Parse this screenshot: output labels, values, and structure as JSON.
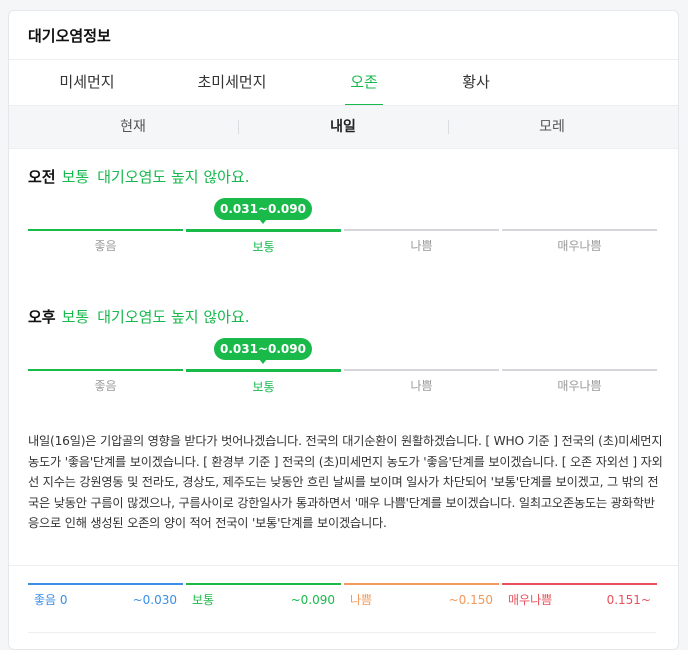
{
  "title": "대기오염정보",
  "tabs": [
    {
      "label": "미세먼지"
    },
    {
      "label": "초미세먼지"
    },
    {
      "label": "오존"
    },
    {
      "label": "황사"
    }
  ],
  "active_tab": "오존",
  "subtabs": [
    {
      "label": "현재"
    },
    {
      "label": "내일"
    },
    {
      "label": "모레"
    }
  ],
  "active_subtab": "내일",
  "periods": [
    {
      "time": "오전",
      "grade": "보통",
      "message": "대기오염도 높지 않아요.",
      "range": "0.031~0.090"
    },
    {
      "time": "오후",
      "grade": "보통",
      "message": "대기오염도 높지 않아요.",
      "range": "0.031~0.090"
    }
  ],
  "scale_labels": [
    "좋음",
    "보통",
    "나쁨",
    "매우나쁨"
  ],
  "description": "내일(16일)은 기압골의 영향을 받다가 벗어나겠습니다. 전국의 대기순환이 원활하겠습니다. [ WHO 기준 ] 전국의 (초)미세먼지 농도가 '좋음'단계를 보이겠습니다. [ 환경부 기준 ] 전국의 (초)미세먼지 농도가 '좋음'단계를 보이겠습니다. [ 오존 자외선 ] 자외선 지수는 강원영동 및 전라도, 경상도, 제주도는 낮동안 흐린 날씨를 보이며 일사가 차단되어 '보통'단계를 보이겠고, 그 밖의 전국은 낮동안 구름이 많겠으나, 구름사이로 강한일사가 통과하면서 '매우 나쁨'단계를 보이겠습니다. 일최고오존농도는 광화학반응으로 인해 생성된 오존의 양이 적어 전국이 '보통'단계를 보이겠습니다.",
  "legend": [
    {
      "name": "좋음 0",
      "range": "~0.030",
      "color": "#3a8ee6"
    },
    {
      "name": "보통",
      "range": "~0.090",
      "color": "#19b94a"
    },
    {
      "name": "나쁨",
      "range": "~0.150",
      "color": "#f29a5c"
    },
    {
      "name": "매우나쁨",
      "range": "0.151~",
      "color": "#e8505b"
    }
  ],
  "colors": {
    "accent": "#19b94a",
    "inactive_bar": "#d4d6d9"
  }
}
